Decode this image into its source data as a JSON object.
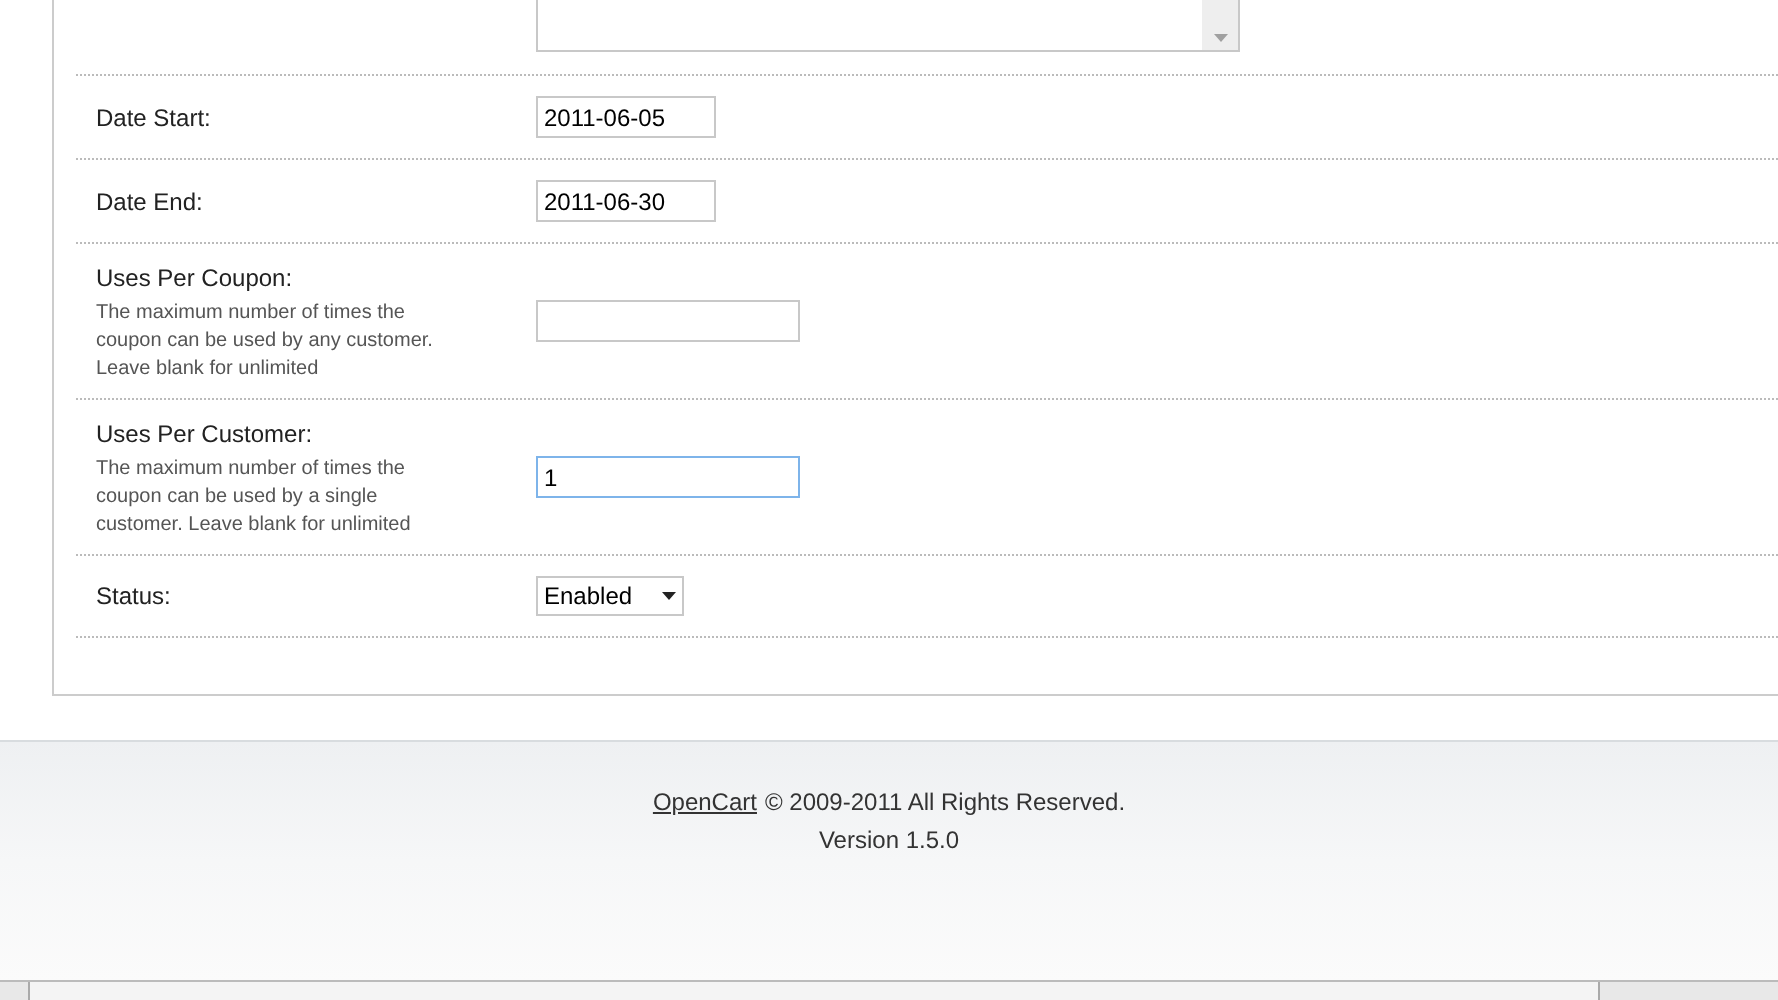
{
  "form": {
    "rows": [
      {
        "kind": "listbox"
      },
      {
        "kind": "date",
        "label": "Date Start:",
        "value": "2011-06-05",
        "focused": false
      },
      {
        "kind": "date",
        "label": "Date End:",
        "value": "2011-06-30",
        "focused": false
      },
      {
        "kind": "text",
        "label": "Uses Per Coupon:",
        "help": "The maximum number of times the coupon can be used by any customer. Leave blank for unlimited",
        "focused": false
      },
      {
        "kind": "text",
        "label": "Uses Per Customer:",
        "help": "The maximum number of times the coupon can be used by a single customer. Leave blank for unlimited",
        "value": "1",
        "focused": true
      },
      {
        "kind": "select",
        "label": "Status:",
        "value": "Enabled"
      }
    ]
  },
  "footer": {
    "link": "OpenCart",
    "notice": "© 2009-2011 All Rights Reserved.",
    "version": "Version 1.5.0"
  }
}
